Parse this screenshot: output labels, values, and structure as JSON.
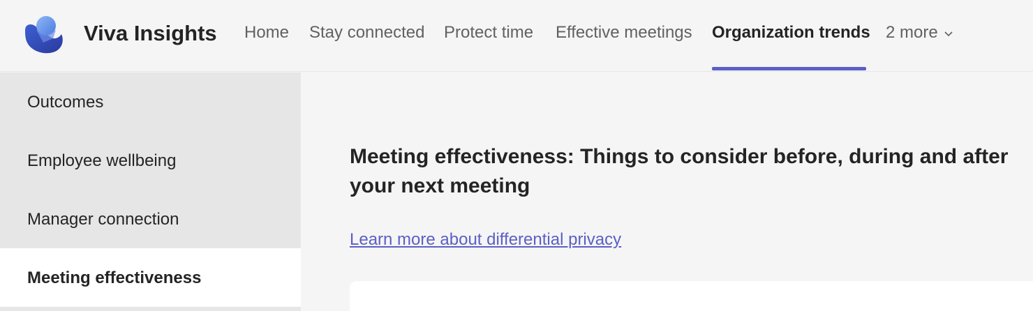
{
  "header": {
    "app_title": "Viva Insights",
    "logo_icon": "viva-insights-logo",
    "accent_color": "#5b5fc7",
    "tabs": [
      {
        "label": "Home"
      },
      {
        "label": "Stay connected"
      },
      {
        "label": "Protect time"
      },
      {
        "label": "Effective meetings"
      },
      {
        "label": "Organization trends",
        "active": true
      },
      {
        "label": "2 more",
        "icon": "chevron-down-icon"
      }
    ]
  },
  "sidebar": {
    "items": [
      {
        "label": "Outcomes"
      },
      {
        "label": "Employee wellbeing"
      },
      {
        "label": "Manager connection"
      },
      {
        "label": "Meeting effectiveness",
        "selected": true
      }
    ]
  },
  "main": {
    "title": "Meeting effectiveness: Things to consider before, during and after your next meeting",
    "privacy_link": "Learn more about differential privacy"
  }
}
